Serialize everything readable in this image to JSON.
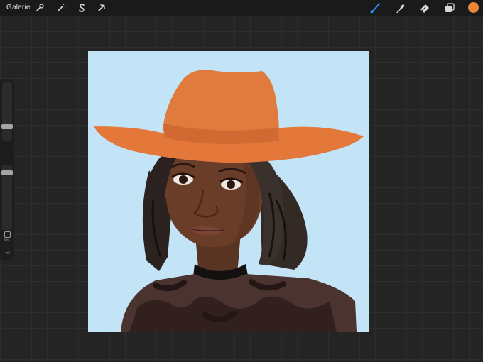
{
  "topbar": {
    "gallery_label": "Galerie",
    "left_tools": [
      {
        "name": "wrench-icon"
      },
      {
        "name": "magic-wand-icon"
      },
      {
        "name": "selection-s-icon"
      },
      {
        "name": "arrow-cursor-icon"
      }
    ],
    "right_tools": [
      {
        "name": "brush-icon",
        "active": true,
        "color": "#2f8fff"
      },
      {
        "name": "smudge-icon"
      },
      {
        "name": "eraser-icon"
      },
      {
        "name": "layers-icon"
      }
    ],
    "current_color": "#e8873b"
  },
  "sidebar": {
    "brush_size_icon": "slider",
    "opacity_icon": "slider",
    "modify_icon": "square-icon",
    "undo_icon": "undo-arrow-icon",
    "redo_icon": "redo-arrow-icon"
  },
  "canvas": {
    "background_color": "#c3e4f6",
    "artwork": "portrait-with-orange-hat"
  }
}
